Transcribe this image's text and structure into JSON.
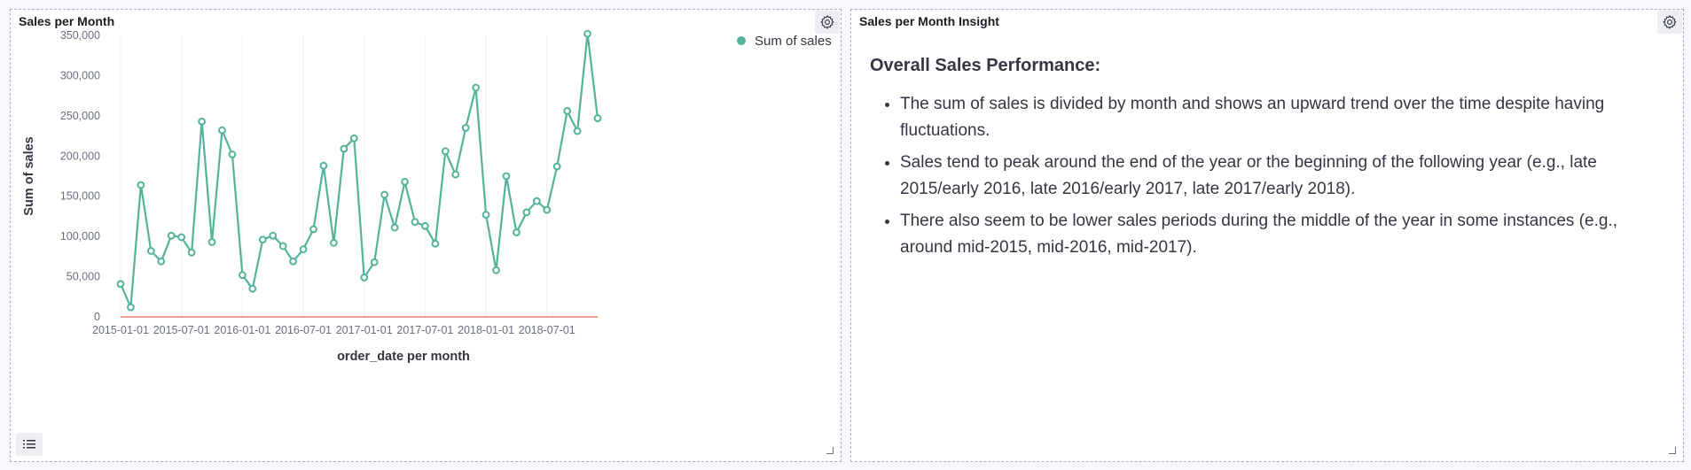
{
  "left_panel": {
    "title": "Sales per Month",
    "icons": {
      "settings": "gear-icon",
      "legend_toggle": "list-icon",
      "resize": "resize-corner-icon"
    }
  },
  "right_panel": {
    "title": "Sales per Month Insight",
    "icons": {
      "settings": "gear-icon",
      "resize": "resize-corner-icon"
    },
    "insight": {
      "heading": "Overall Sales Performance:",
      "bullets": [
        "The sum of sales is divided by month and shows an upward trend over the time despite having fluctuations.",
        "Sales tend to peak around the end of the year or the beginning of the following year (e.g., late 2015/early 2016, late 2016/early 2017, late 2017/early 2018).",
        "There also seem to be lower sales periods during the middle of the year in some instances (e.g., around mid-2015, mid-2016, mid-2017)."
      ]
    }
  },
  "colors": {
    "series": "#54b399",
    "baseline": "#e7664c",
    "grid": "#eef0f4"
  },
  "chart_data": {
    "type": "line",
    "xlabel": "order_date per month",
    "ylabel": "Sum of sales",
    "ylim": [
      0,
      350000
    ],
    "yticks": [
      "0",
      "50,000",
      "100,000",
      "150,000",
      "200,000",
      "250,000",
      "300,000",
      "350,000"
    ],
    "xticks": [
      "2015-01-01",
      "2015-07-01",
      "2016-01-01",
      "2016-07-01",
      "2017-01-01",
      "2017-07-01",
      "2018-01-01",
      "2018-07-01"
    ],
    "legend_position": "top-right",
    "grid": "vertical",
    "series": [
      {
        "name": "Sum of sales",
        "start": "2015-01",
        "values": [
          41000,
          12000,
          164000,
          82000,
          69000,
          101000,
          99000,
          80000,
          243000,
          93000,
          232000,
          202000,
          52000,
          35000,
          96000,
          101000,
          88000,
          69000,
          84000,
          109000,
          188000,
          92000,
          209000,
          222000,
          49000,
          68000,
          152000,
          111000,
          168000,
          118000,
          113000,
          91000,
          206000,
          177000,
          235000,
          285000,
          127000,
          58000,
          175000,
          105000,
          130000,
          144000,
          133000,
          187000,
          256000,
          231000,
          352000,
          247000
        ]
      }
    ]
  }
}
